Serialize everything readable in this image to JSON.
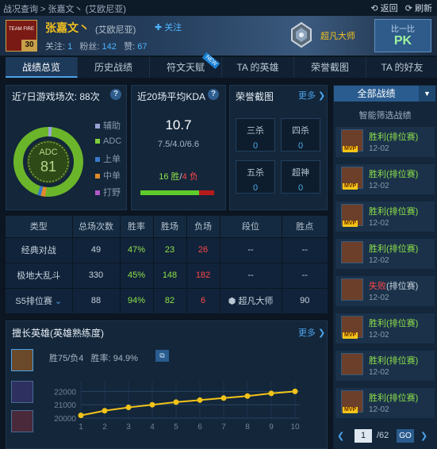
{
  "topbar": {
    "crumb": "战况查询 > 张嘉文丶 (艾欧尼亚)",
    "back": "返回",
    "refresh": "刷新"
  },
  "player": {
    "team": "TEAM FIRE",
    "level": "30",
    "name": "张嘉文丶",
    "server": "(艾欧尼亚)",
    "follow_label": "关注",
    "follows_label": "关注:",
    "follows": "1",
    "fans_label": "粉丝:",
    "fans": "142",
    "likes_label": "赞:",
    "likes": "67",
    "rank": "超凡大师"
  },
  "pk": {
    "small": "比一比",
    "big": "PK"
  },
  "tabs": [
    "战绩总览",
    "历史战绩",
    "符文天赋",
    "TA 的英雄",
    "荣誉截图",
    "TA 的好友"
  ],
  "new_tag": "NEW",
  "games7": {
    "title": "近7日游戏场次: 88次",
    "role": "ADC",
    "score": "81",
    "legend": [
      {
        "label": "辅助",
        "color": "#9aa3d6"
      },
      {
        "label": "ADC",
        "color": "#7fcf3a"
      },
      {
        "label": "上单",
        "color": "#3a79c9"
      },
      {
        "label": "中单",
        "color": "#e08a2a"
      },
      {
        "label": "打野",
        "color": "#b058c9"
      }
    ]
  },
  "kda": {
    "title": "近20场平均KDA",
    "value": "10.7",
    "detail": "7.5/4.0/6.6",
    "wins": "16 胜",
    "sep": "/",
    "losses": "4 负",
    "win_ratio": 0.8
  },
  "honor": {
    "title": "荣誉截图",
    "more": "更多",
    "items": [
      {
        "label": "三杀",
        "value": "0"
      },
      {
        "label": "四杀",
        "value": "0"
      },
      {
        "label": "五杀",
        "value": "0"
      },
      {
        "label": "超神",
        "value": "0"
      }
    ]
  },
  "stats": {
    "headers": [
      "类型",
      "总场次数",
      "胜率",
      "胜场",
      "负场",
      "段位",
      "胜点"
    ],
    "rows": [
      [
        "经典对战",
        "49",
        "47%",
        "23",
        "26",
        "--",
        "--"
      ],
      [
        "极地大乱斗",
        "330",
        "45%",
        "148",
        "182",
        "--",
        "--"
      ],
      [
        "S5排位赛",
        "88",
        "94%",
        "82",
        "6",
        "超凡大师",
        "90"
      ]
    ]
  },
  "heroes": {
    "title": "擅长英雄(英雄熟练度)",
    "more": "更多",
    "summary": "胜75/负4",
    "winrate": "胜率: 94.9%"
  },
  "chart_data": {
    "type": "line",
    "categories": [
      "1",
      "2",
      "3",
      "4",
      "5",
      "6",
      "7",
      "8",
      "9",
      "10"
    ],
    "values": [
      20200,
      20550,
      20800,
      21000,
      21200,
      21350,
      21500,
      21650,
      21850,
      22000
    ],
    "yticks": [
      "22000",
      "21000",
      "20000"
    ],
    "ylim": [
      20000,
      22500
    ]
  },
  "matches": {
    "all_label": "全部战绩",
    "smart_label": "智能筛选战绩",
    "mvp": "MVP",
    "items": [
      {
        "result": "胜利",
        "type": "(排位赛)",
        "date": "12-02",
        "mvp": true,
        "win": true
      },
      {
        "result": "胜利",
        "type": "(排位赛)",
        "date": "12-02",
        "mvp": true,
        "win": true
      },
      {
        "result": "胜利",
        "type": "(排位赛)",
        "date": "12-02",
        "mvp": true,
        "win": true
      },
      {
        "result": "胜利",
        "type": "(排位赛)",
        "date": "12-02",
        "mvp": false,
        "win": true
      },
      {
        "result": "失败",
        "type": "(排位赛)",
        "date": "12-02",
        "mvp": false,
        "win": false
      },
      {
        "result": "胜利",
        "type": "(排位赛)",
        "date": "12-02",
        "mvp": true,
        "win": true
      },
      {
        "result": "胜利",
        "type": "(排位赛)",
        "date": "12-02",
        "mvp": false,
        "win": true
      },
      {
        "result": "胜利",
        "type": "(排位赛)",
        "date": "12-02",
        "mvp": true,
        "win": true
      }
    ]
  },
  "pager": {
    "current": "1",
    "total": "/62",
    "go": "GO"
  },
  "colors": {
    "gold": "#f0c020",
    "blue": "#4cb4ff",
    "win": "#8ee04a",
    "loss": "#ff4747"
  }
}
